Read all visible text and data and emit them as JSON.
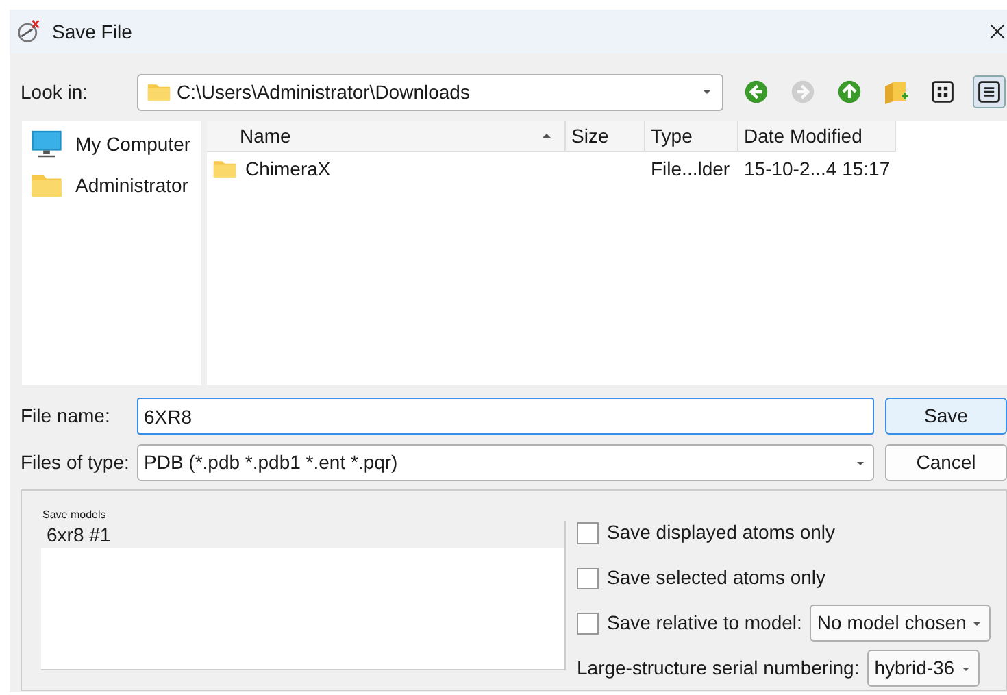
{
  "window": {
    "title": "Save File"
  },
  "look_in": {
    "label": "Look in:",
    "path": "C:\\Users\\Administrator\\Downloads"
  },
  "toolbar": [
    {
      "kind": "back",
      "disabled": false
    },
    {
      "kind": "forward",
      "disabled": true
    },
    {
      "kind": "up",
      "disabled": false
    },
    {
      "kind": "new-folder",
      "disabled": false
    },
    {
      "kind": "icon-view",
      "selected": false
    },
    {
      "kind": "detail-view",
      "selected": true
    }
  ],
  "sidebar": {
    "items": [
      {
        "kind": "computer",
        "label": "My Computer"
      },
      {
        "kind": "folder",
        "label": "Administrator"
      }
    ]
  },
  "table": {
    "columns": [
      {
        "label": "Name",
        "sorted": true
      },
      {
        "label": "Size",
        "sorted": false
      },
      {
        "label": "Type",
        "sorted": false
      },
      {
        "label": "Date Modified",
        "sorted": false
      }
    ],
    "rows": [
      {
        "cells": [
          "ChimeraX",
          "",
          "File...lder",
          "15-10-2...4 15:17"
        ],
        "selected": false
      }
    ]
  },
  "file_name": {
    "label": "File name:",
    "value": "6XR8"
  },
  "file_type": {
    "label": "Files of type:",
    "value": "PDB (*.pdb *.pdb1 *.ent *.pqr)"
  },
  "buttons": [
    "Save",
    "Cancel"
  ],
  "options": {
    "models_label": "Save models",
    "models": [
      {
        "label": "6xr8 #1",
        "selected": true
      }
    ],
    "checks": [
      {
        "kind": "checkbox",
        "label": "Save displayed atoms only",
        "checked": false
      },
      {
        "kind": "checkbox",
        "label": "Save selected atoms only",
        "checked": false
      },
      {
        "kind": "checkbox-select",
        "label": "Save relative to model:",
        "checked": false,
        "value": "No model chosen"
      },
      {
        "kind": "select",
        "label": "Large-structure serial numbering:",
        "value": "hybrid-36"
      }
    ]
  }
}
